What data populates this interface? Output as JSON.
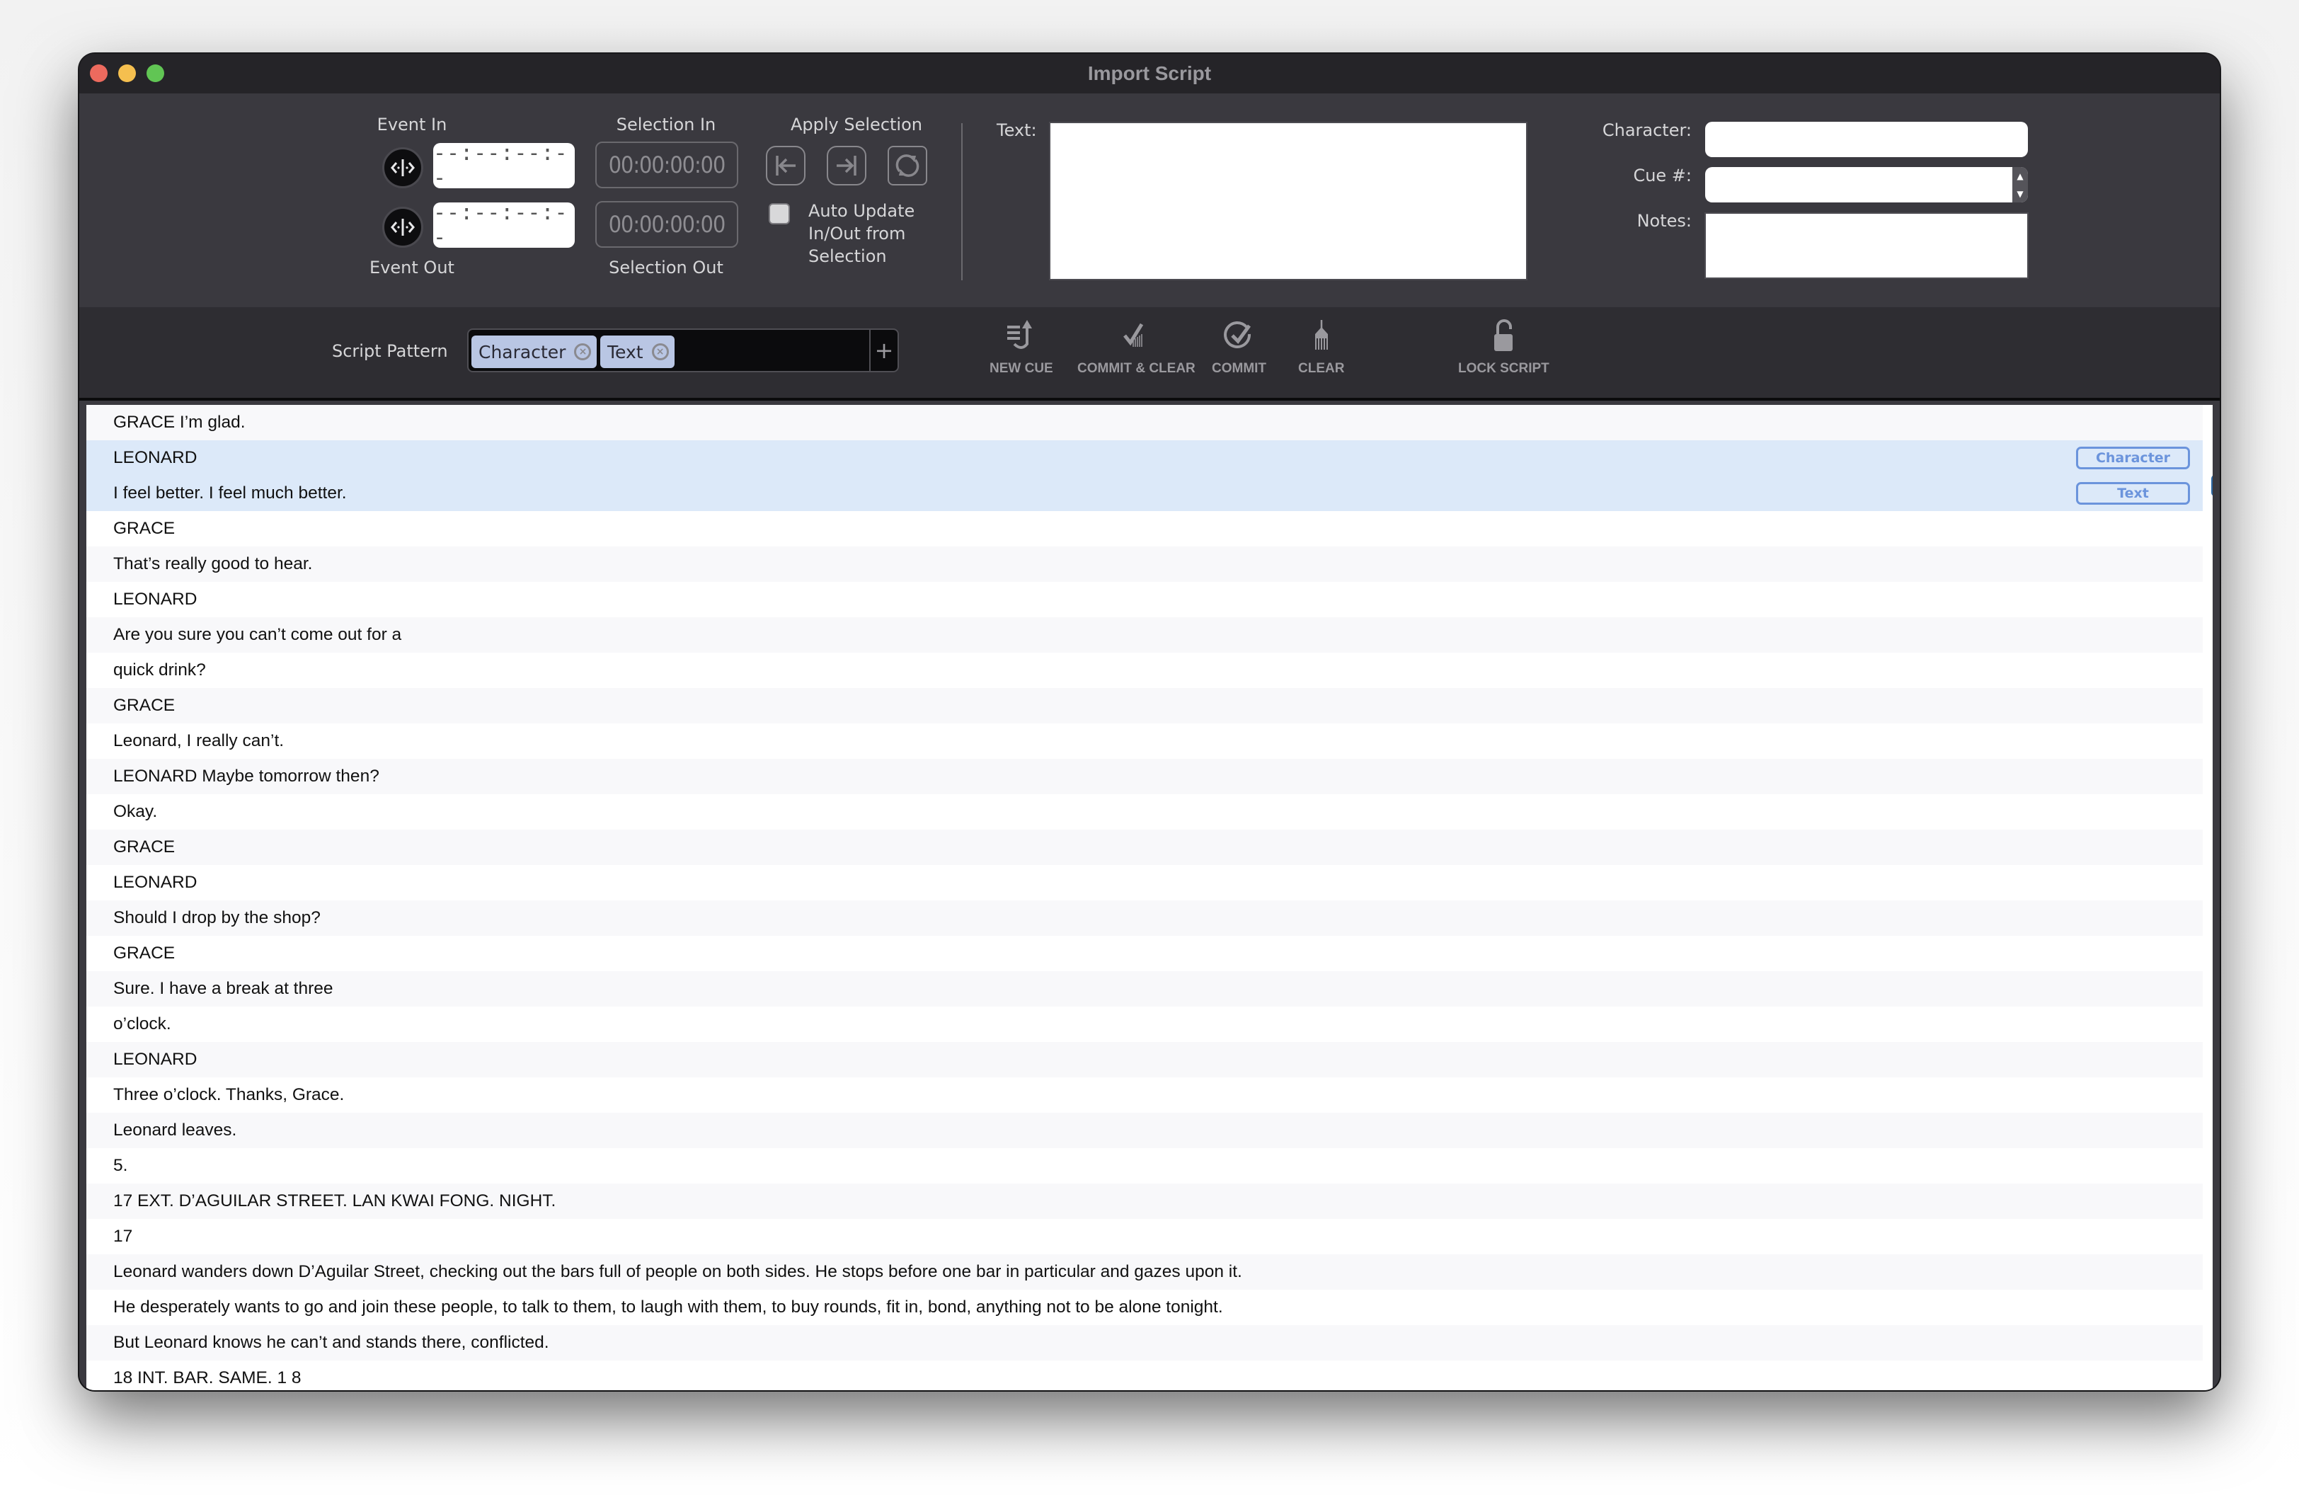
{
  "window": {
    "title": "Import Script"
  },
  "header": {
    "event_in_label": "Event In",
    "event_out_label": "Event Out",
    "event_in_value": "--:--:--:--",
    "event_out_value": "--:--:--:--",
    "selection_in_label": "Selection In",
    "selection_out_label": "Selection Out",
    "selection_in_value": "00:00:00:00",
    "selection_out_value": "00:00:00:00",
    "apply_selection_label": "Apply Selection",
    "auto_update_label_1": "Auto Update",
    "auto_update_label_2": "In/Out from",
    "auto_update_label_3": "Selection",
    "auto_update_checked": false,
    "text_label": "Text:",
    "text_value": "",
    "character_label": "Character:",
    "character_value": "",
    "cue_label": "Cue #:",
    "cue_value": "",
    "notes_label": "Notes:",
    "notes_value": ""
  },
  "toolbar": {
    "script_pattern_label": "Script Pattern",
    "pattern_chips": [
      "Character",
      "Text"
    ],
    "add_label": "+",
    "buttons": {
      "new_cue": "NEW CUE",
      "commit_clear": "COMMIT & CLEAR",
      "commit": "COMMIT",
      "clear": "CLEAR",
      "lock_script": "LOCK SCRIPT"
    }
  },
  "script": {
    "rows": [
      "GRACE I’m glad.",
      "LEONARD",
      "I feel better. I feel much better.",
      "GRACE",
      "That’s really good to hear.",
      "LEONARD",
      "Are you sure you can’t come out for a",
      "quick drink?",
      "GRACE",
      "Leonard, I really can’t.",
      "LEONARD Maybe tomorrow then?",
      "Okay.",
      "GRACE",
      "LEONARD",
      "Should I drop by the shop?",
      "GRACE",
      "Sure. I have a break at three",
      "o’clock.",
      "LEONARD",
      "Three o’clock. Thanks, Grace.",
      "Leonard leaves.",
      "5.",
      "17 EXT. D’AGUILAR STREET. LAN KWAI FONG. NIGHT.",
      "17",
      "Leonard wanders down D’Aguilar Street, checking out the bars full of people on both sides. He stops before one bar in particular and gazes upon it.",
      "He desperately wants to go and join these people, to talk to them, to laugh with them, to buy rounds, fit in, bond, anything not to be alone tonight.",
      "But Leonard knows he can’t and stands there, conflicted.",
      "18 INT. BAR. SAME. 1 8"
    ],
    "selected_rows": [
      1,
      2
    ],
    "row_tags": {
      "1": "Character",
      "2": "Text"
    }
  },
  "colors": {
    "accent": "#6b94dc",
    "selection_bg": "#dce9f9",
    "scroll_thumb": "#2f6aa6",
    "chip_bg": "#b9c6e4"
  }
}
